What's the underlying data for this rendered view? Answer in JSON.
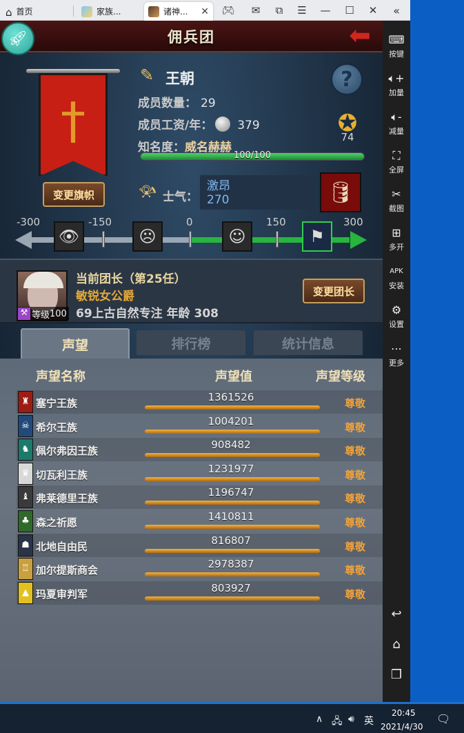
{
  "browser": {
    "tabs": [
      {
        "label": "首页",
        "icon": "home-icon"
      },
      {
        "label": "家族...",
        "icon": "game-icon"
      },
      {
        "label": "诸神...",
        "icon": "game-icon"
      }
    ],
    "controls": [
      "gamepad-icon",
      "mail-icon",
      "screenshot-icon",
      "menu-icon",
      "minimize-icon",
      "maximize-icon",
      "close-icon",
      "collapse-icon"
    ]
  },
  "sidebar": {
    "items": [
      {
        "label": "按键",
        "icon": "keyboard-icon"
      },
      {
        "label": "加量",
        "icon": "volume-up-icon"
      },
      {
        "label": "减量",
        "icon": "volume-down-icon"
      },
      {
        "label": "全屏",
        "icon": "fullscreen-icon"
      },
      {
        "label": "截图",
        "icon": "scissors-icon"
      },
      {
        "label": "多开",
        "icon": "multi-instance-icon"
      },
      {
        "label": "安装",
        "icon": "apk-icon"
      },
      {
        "label": "设置",
        "icon": "settings-icon"
      },
      {
        "label": "更多",
        "icon": "more-icon"
      }
    ],
    "nav": [
      "back-icon",
      "home-icon",
      "recent-apps-icon"
    ]
  },
  "game": {
    "title": "佣兵团",
    "guild_name": "王朝",
    "member_count_label": "成员数量：",
    "member_count": "29",
    "salary_label": "成员工资/年：",
    "salary": "379",
    "fame_label": "知名度：",
    "fame_value": "威名赫赫",
    "fame_progress": "100/100",
    "fame_fraction": 1.0,
    "badge_count": "74",
    "change_banner_label": "变更旗帜",
    "morale_label": "士气：",
    "morale_state": "激昂",
    "morale_value": "270",
    "morale_ticks": [
      "-300",
      "-150",
      "0",
      "150",
      "300"
    ],
    "leader": {
      "title": "当前团长（第25任）",
      "name": "敏锐女公爵",
      "description": "69上古自然专注  年龄  308",
      "level_label": "等级",
      "level": "100",
      "change_label": "变更团长"
    },
    "tabs": [
      "声望",
      "排行榜",
      "统计信息"
    ],
    "active_tab": "声望",
    "reputation": {
      "headers": [
        "声望名称",
        "声望值",
        "声望等级"
      ],
      "rows": [
        {
          "name": "塞宁王族",
          "value": "1361526",
          "level": "尊敬",
          "color": "#9c1d14"
        },
        {
          "name": "希尔王族",
          "value": "1004201",
          "level": "尊敬",
          "color": "#214a7a"
        },
        {
          "name": "佩尔弗因王族",
          "value": "908482",
          "level": "尊敬",
          "color": "#1c7a6a"
        },
        {
          "name": "切瓦利王族",
          "value": "1231977",
          "level": "尊敬",
          "color": "#d8d8d8"
        },
        {
          "name": "弗莱德里王族",
          "value": "1196747",
          "level": "尊敬",
          "color": "#3a3a3a"
        },
        {
          "name": "森之祈愿",
          "value": "1410811",
          "level": "尊敬",
          "color": "#2f6a2a"
        },
        {
          "name": "北地自由民",
          "value": "816807",
          "level": "尊敬",
          "color": "#2a3446"
        },
        {
          "name": "加尔提斯商会",
          "value": "2978387",
          "level": "尊敬",
          "color": "#c8a040"
        },
        {
          "name": "玛夏审判军",
          "value": "803927",
          "level": "尊敬",
          "color": "#e2c020"
        }
      ]
    }
  },
  "taskbar": {
    "ime": "英",
    "time": "20:45",
    "date": "2021/4/30"
  }
}
